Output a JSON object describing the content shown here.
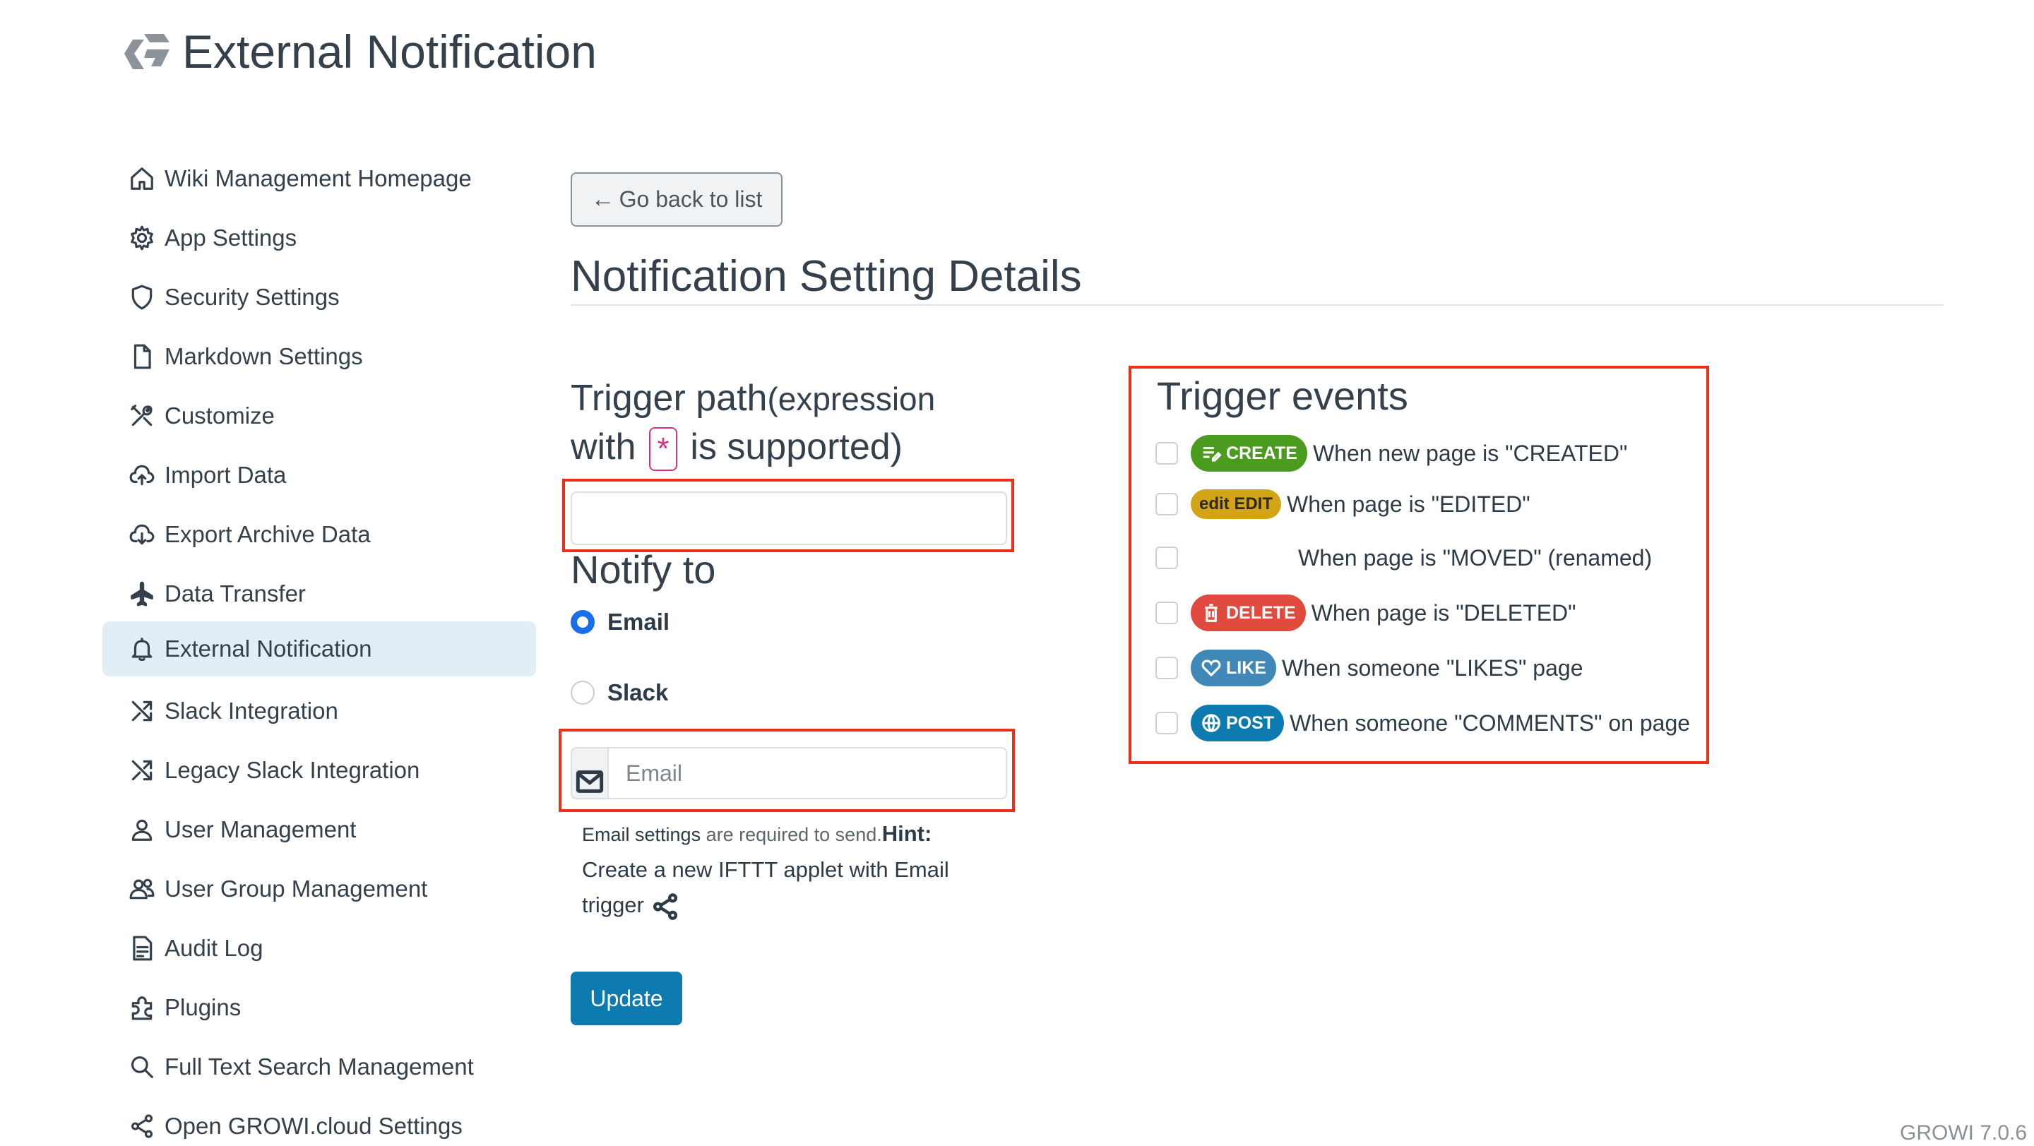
{
  "header": {
    "title": "External Notification"
  },
  "sidebar": {
    "items": [
      {
        "label": "Wiki Management Homepage",
        "icon": "home-icon"
      },
      {
        "label": "App Settings",
        "icon": "gear-icon"
      },
      {
        "label": "Security Settings",
        "icon": "shield-icon"
      },
      {
        "label": "Markdown Settings",
        "icon": "file-icon"
      },
      {
        "label": "Customize",
        "icon": "tools-icon"
      },
      {
        "label": "Import Data",
        "icon": "cloud-upload-icon"
      },
      {
        "label": "Export Archive Data",
        "icon": "cloud-download-icon"
      },
      {
        "label": "Data Transfer",
        "icon": "airplane-icon"
      },
      {
        "label": "External Notification",
        "icon": "bell-icon",
        "active": true
      },
      {
        "label": "Slack Integration",
        "icon": "shuffle-icon"
      },
      {
        "label": "Legacy Slack Integration",
        "icon": "shuffle-icon"
      },
      {
        "label": "User Management",
        "icon": "person-icon"
      },
      {
        "label": "User Group Management",
        "icon": "people-icon"
      },
      {
        "label": "Audit Log",
        "icon": "document-icon"
      },
      {
        "label": "Plugins",
        "icon": "puzzle-icon"
      },
      {
        "label": "Full Text Search Management",
        "icon": "search-icon"
      },
      {
        "label": "Open GROWI.cloud Settings",
        "icon": "share-icon"
      }
    ]
  },
  "main": {
    "back_label": "Go back to list",
    "heading": "Notification Setting Details",
    "trigger_path": {
      "label_main": "Trigger path",
      "label_sub": "(expression",
      "label_with": "with",
      "asterisk": "*",
      "label_end": "is supported)",
      "value": ""
    },
    "notify_to": {
      "label": "Notify to",
      "options": [
        "Email",
        "Slack"
      ],
      "selected": "Email"
    },
    "email": {
      "placeholder": "Email",
      "value": ""
    },
    "hint": {
      "settings_link": "Email settings",
      "required_text": " are required to send.",
      "hint_label": "Hint:",
      "hint_text": "Create a new IFTTT applet with Email trigger"
    },
    "update_label": "Update"
  },
  "trigger_events": {
    "title": "Trigger events",
    "events": [
      {
        "badge": "CREATE",
        "text": "When new page is \"CREATED\"",
        "color": "#4a9b1e",
        "icon": "create-icon",
        "checked": false
      },
      {
        "badge": "edit EDIT",
        "text": "When page is \"EDITED\"",
        "color": "#d4a417",
        "icon": "",
        "checked": false
      },
      {
        "badge": "",
        "text": "When page is \"MOVED\" (renamed)",
        "color": "",
        "icon": "",
        "checked": false
      },
      {
        "badge": "DELETE",
        "text": "When page is \"DELETED\"",
        "color": "#e04a3f",
        "icon": "trash-icon",
        "checked": false
      },
      {
        "badge": "LIKE",
        "text": "When someone \"LIKES\" page",
        "color": "#3f88b8",
        "icon": "heart-icon",
        "checked": false
      },
      {
        "badge": "POST",
        "text": "When someone \"COMMENTS\" on page",
        "color": "#0d7bb0",
        "icon": "globe-icon",
        "checked": false
      }
    ]
  },
  "footer": {
    "version": "GROWI 7.0.6"
  },
  "colors": {
    "accent": "#0d7bb0",
    "highlight": "#e8301c",
    "active_nav": "#e2eef6"
  }
}
